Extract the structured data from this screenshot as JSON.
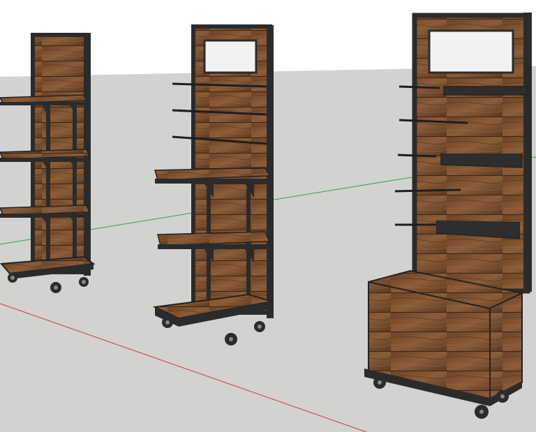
{
  "scene": {
    "sky_color": "#ffffff",
    "ground_color": "#d2d2d0",
    "wood_light": "#8a5a35",
    "wood_dark": "#5a3a22",
    "metal_color": "#2b2b2b",
    "panel_color": "#f2f2f2",
    "axis_red": "#c23a3a",
    "axis_green": "#2fa34a"
  }
}
